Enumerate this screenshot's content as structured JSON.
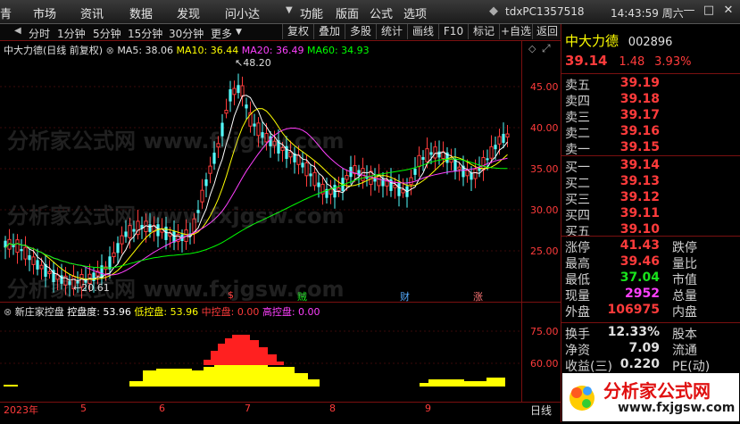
{
  "menu": {
    "items": [
      "青",
      "市场",
      "资讯",
      "数据",
      "发现",
      "问小达",
      "功能",
      "版面",
      "公式",
      "选项"
    ],
    "account": "tdxPC1357518",
    "clock": "14:43:59 周六"
  },
  "period_bar": {
    "items": [
      "分时",
      "1分钟",
      "5分钟",
      "15分钟",
      "30分钟",
      "更多"
    ],
    "tools": [
      "复权",
      "叠加",
      "多股",
      "统计",
      "画线",
      "F10",
      "标记",
      "+自选",
      "返回"
    ]
  },
  "chart": {
    "info_title": "中大力德(日线 前复权)",
    "ma5": "MA5: 38.06",
    "ma10": "MA10: 36.44",
    "ma20": "MA20: 36.49",
    "ma60": "MA60: 34.93",
    "high_label": "48.20",
    "low_label": "20.61",
    "price_axis": [
      "45.00",
      "40.00",
      "35.00",
      "30.00",
      "25.00"
    ],
    "events": [
      "$",
      "贼",
      "财",
      "涨"
    ],
    "dates": [
      "2023年",
      "5",
      "6",
      "7",
      "8",
      "9"
    ],
    "corner_label": "日线",
    "colors": {
      "ma5": "#ffffff",
      "ma10": "#ffff00",
      "ma20": "#ff40ff",
      "ma60": "#00ff00",
      "up": "#ff3b3b",
      "down": "#54ffff"
    }
  },
  "sub_chart": {
    "title": "新庄家控盘",
    "kongpan": "控盘度: 53.96",
    "low": "低控盘: 53.96",
    "mid": "中控盘: 0.00",
    "high": "高控盘: 0.00",
    "axis": [
      "75.00",
      "60.00"
    ]
  },
  "watermark": {
    "text1": "分析家公式网 www.fxjgsw.com",
    "text2": "分析家公式网 www.fxjgsw.com",
    "text3": "分析家公式网 www.fxjgsw.com"
  },
  "quote": {
    "name": "中大力德",
    "code": "002896",
    "price": "39.14",
    "change": "1.48",
    "pct": "3.93%",
    "sell": [
      {
        "label": "卖五",
        "price": "39.19"
      },
      {
        "label": "卖四",
        "price": "39.18"
      },
      {
        "label": "卖三",
        "price": "39.17"
      },
      {
        "label": "卖二",
        "price": "39.16"
      },
      {
        "label": "卖一",
        "price": "39.15"
      }
    ],
    "buy": [
      {
        "label": "买一",
        "price": "39.14"
      },
      {
        "label": "买二",
        "price": "39.13"
      },
      {
        "label": "买三",
        "price": "39.12"
      },
      {
        "label": "买四",
        "price": "39.11"
      },
      {
        "label": "买五",
        "price": "39.10"
      }
    ],
    "stats": [
      {
        "label": "涨停",
        "value": "41.43",
        "right": "跌停",
        "color": "red"
      },
      {
        "label": "最高",
        "value": "39.46",
        "right": "量比",
        "color": "red"
      },
      {
        "label": "最低",
        "value": "37.04",
        "right": "市值",
        "color": "green"
      },
      {
        "label": "现量",
        "value": "2952",
        "right": "总量",
        "color": "magenta"
      },
      {
        "label": "外盘",
        "value": "106975",
        "right": "内盘",
        "color": "red"
      }
    ],
    "stats2": [
      {
        "label": "换手",
        "value": "12.33%",
        "right": "股本"
      },
      {
        "label": "净资",
        "value": "7.09",
        "right": "流通"
      },
      {
        "label": "收益(三)",
        "value": "0.220",
        "right": "PE(动)"
      }
    ]
  },
  "logo": {
    "cn": "分析家公式网",
    "url": "www.fxjgsw.com"
  }
}
